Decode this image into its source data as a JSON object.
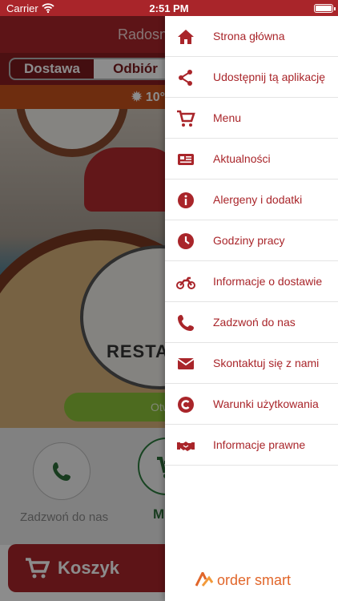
{
  "status_bar": {
    "carrier": "Carrier",
    "time": "2:51 PM"
  },
  "background_app": {
    "title": "Radosny",
    "tabs": [
      {
        "label": "Dostawa",
        "selected": true
      },
      {
        "label": "Odbiór",
        "selected": false
      }
    ],
    "temperature": "10",
    "hero": {
      "logo_text": "RESTA",
      "open_button": "Otw"
    },
    "actions": {
      "call_label": "Zadzwoń do nas",
      "menu_label": "M"
    },
    "cart_label": "Koszyk"
  },
  "drawer": {
    "items": [
      {
        "label": "Strona główna",
        "icon": "home-icon"
      },
      {
        "label": "Udostępnij tą aplikację",
        "icon": "share-icon"
      },
      {
        "label": "Menu",
        "icon": "cart-icon"
      },
      {
        "label": "Aktualności",
        "icon": "news-icon"
      },
      {
        "label": "Alergeny i dodatki",
        "icon": "info-icon"
      },
      {
        "label": "Godziny pracy",
        "icon": "clock-icon"
      },
      {
        "label": "Informacje o dostawie",
        "icon": "motorcycle-icon"
      },
      {
        "label": "Zadzwoń do nas",
        "icon": "phone-icon"
      },
      {
        "label": "Skontaktuj się z nami",
        "icon": "envelope-icon"
      },
      {
        "label": "Warunki użytkowania",
        "icon": "copyright-icon"
      },
      {
        "label": "Informacje prawne",
        "icon": "handshake-icon"
      }
    ],
    "brand": {
      "part1": "order",
      "part2": "smart"
    }
  },
  "colors": {
    "primary": "#a9252a",
    "accent_orange": "#e1662a",
    "green": "#8cc43a"
  }
}
